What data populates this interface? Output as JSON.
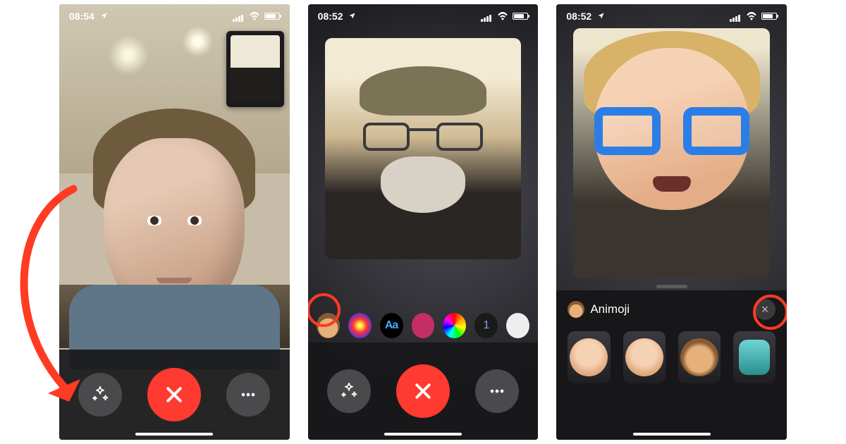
{
  "panel1": {
    "status": {
      "time": "08:54"
    },
    "callbar": {
      "effects_button": "effects",
      "end_button": "end",
      "more_button": "more"
    }
  },
  "panel2": {
    "status": {
      "time": "08:52"
    },
    "effects": {
      "animoji": "animoji",
      "filters": "filters",
      "text_label": "Aa",
      "shapes": "shapes",
      "rgb": "color",
      "onepass": "1",
      "ghost": "ghost"
    },
    "callbar": {
      "effects_button": "effects",
      "end_button": "end",
      "more_button": "more"
    }
  },
  "panel3": {
    "status": {
      "time": "08:52"
    },
    "animoji_panel": {
      "title": "Animoji",
      "close": "×",
      "options": [
        "memoji-1",
        "memoji-2",
        "monkey",
        "robot"
      ]
    }
  }
}
